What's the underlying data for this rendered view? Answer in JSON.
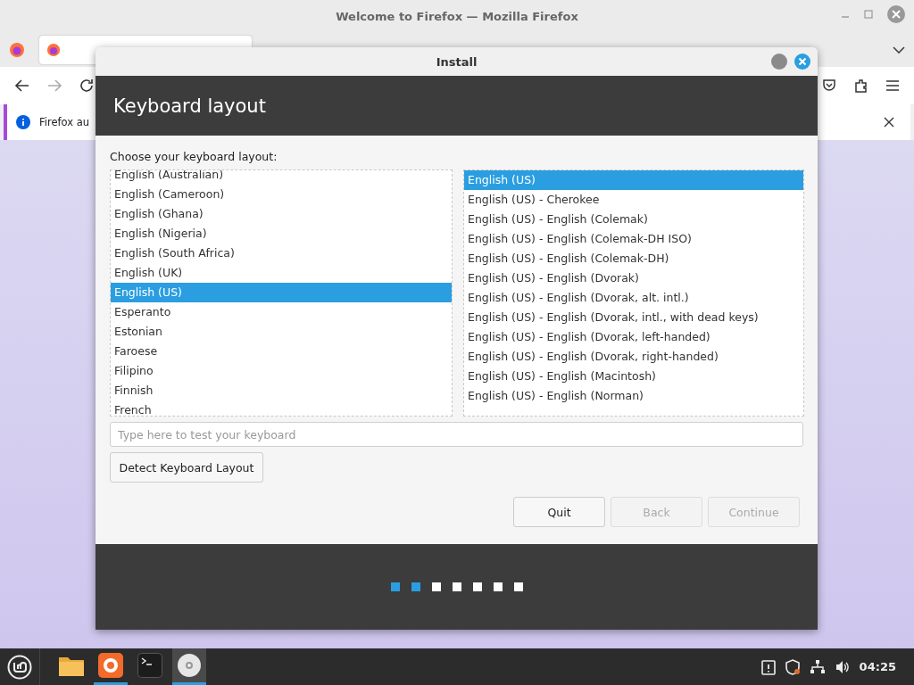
{
  "firefox": {
    "title": "Welcome to Firefox — Mozilla Firefox",
    "notification": "Firefox au"
  },
  "dialog": {
    "title": "Install",
    "heading": "Keyboard layout",
    "prompt": "Choose your keyboard layout:",
    "layouts": [
      {
        "label": "English (Australian)",
        "selected": false
      },
      {
        "label": "English (Cameroon)",
        "selected": false
      },
      {
        "label": "English (Ghana)",
        "selected": false
      },
      {
        "label": "English (Nigeria)",
        "selected": false
      },
      {
        "label": "English (South Africa)",
        "selected": false
      },
      {
        "label": "English (UK)",
        "selected": false
      },
      {
        "label": "English (US)",
        "selected": true
      },
      {
        "label": "Esperanto",
        "selected": false
      },
      {
        "label": "Estonian",
        "selected": false
      },
      {
        "label": "Faroese",
        "selected": false
      },
      {
        "label": "Filipino",
        "selected": false
      },
      {
        "label": "Finnish",
        "selected": false
      },
      {
        "label": "French",
        "selected": false
      }
    ],
    "variants": [
      {
        "label": "English (US)",
        "selected": true
      },
      {
        "label": "English (US) - Cherokee",
        "selected": false
      },
      {
        "label": "English (US) - English (Colemak)",
        "selected": false
      },
      {
        "label": "English (US) - English (Colemak-DH ISO)",
        "selected": false
      },
      {
        "label": "English (US) - English (Colemak-DH)",
        "selected": false
      },
      {
        "label": "English (US) - English (Dvorak)",
        "selected": false
      },
      {
        "label": "English (US) - English (Dvorak, alt. intl.)",
        "selected": false
      },
      {
        "label": "English (US) - English (Dvorak, intl., with dead keys)",
        "selected": false
      },
      {
        "label": "English (US) - English (Dvorak, left-handed)",
        "selected": false
      },
      {
        "label": "English (US) - English (Dvorak, right-handed)",
        "selected": false
      },
      {
        "label": "English (US) - English (Macintosh)",
        "selected": false
      },
      {
        "label": "English (US) - English (Norman)",
        "selected": false
      }
    ],
    "test_field": {
      "placeholder": "Type here to test your keyboard"
    },
    "detect_button": "Detect Keyboard Layout",
    "buttons": [
      {
        "label": "Quit",
        "disabled": false
      },
      {
        "label": "Back",
        "disabled": true
      },
      {
        "label": "Continue",
        "disabled": true
      }
    ],
    "steps": [
      {
        "done": true
      },
      {
        "done": true
      },
      {
        "done": false
      },
      {
        "done": false
      },
      {
        "done": false
      },
      {
        "done": false
      },
      {
        "done": false
      }
    ]
  },
  "taskbar": {
    "apps": [
      {
        "kind": "folder",
        "running": false,
        "selected": false
      },
      {
        "kind": "browser",
        "running": true,
        "selected": false
      },
      {
        "kind": "terminal",
        "running": false,
        "selected": false
      },
      {
        "kind": "disc",
        "running": true,
        "selected": true
      }
    ],
    "clock": "04:25"
  }
}
